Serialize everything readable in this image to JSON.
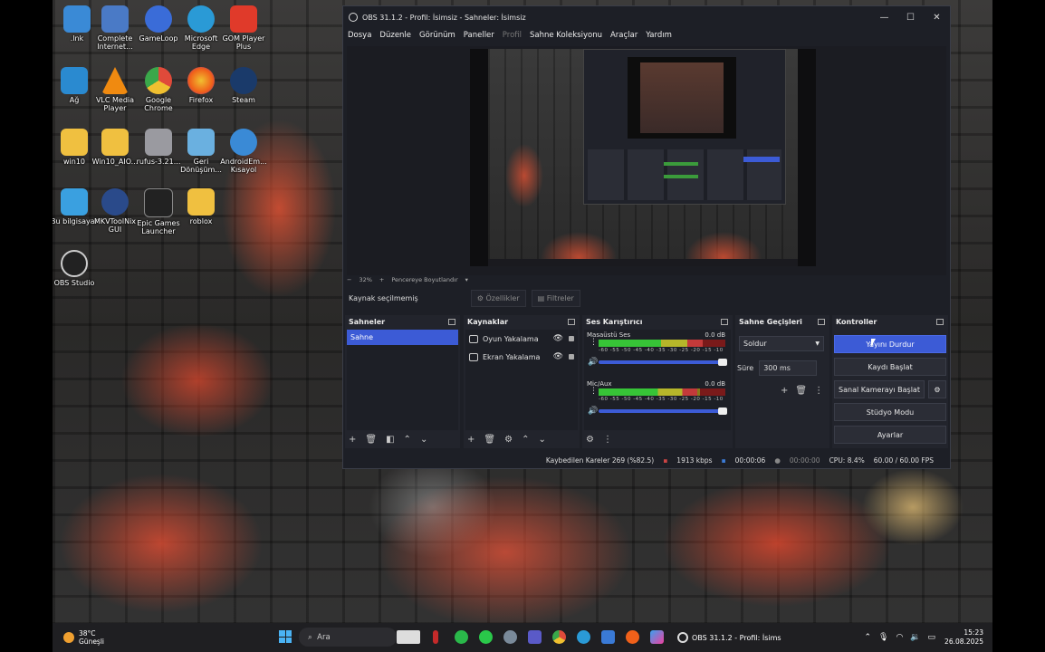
{
  "desktop": {
    "icons": [
      {
        "label": ".lnk",
        "color": "#3a8ad6"
      },
      {
        "label": "Complete Internet...",
        "color": "#4a7ac6"
      },
      {
        "label": "GameLoop",
        "color": "#3a6cd8"
      },
      {
        "label": "Microsoft Edge",
        "color": "#2a9ad6"
      },
      {
        "label": "GOM Player Plus",
        "color": "#e03a2a"
      },
      {
        "label": "Ağ",
        "color": "#2a8ad0"
      },
      {
        "label": "VLC Media Player",
        "color": "#f08a10"
      },
      {
        "label": "Google Chrome",
        "color": "#3aa84a"
      },
      {
        "label": "Firefox",
        "color": "#f0601a"
      },
      {
        "label": "Steam",
        "color": "#1a3a6a"
      },
      {
        "label": "win10",
        "color": "#f0c040"
      },
      {
        "label": "Win10_AIO...",
        "color": "#f0c040"
      },
      {
        "label": "rufus-3.21...",
        "color": "#9a9aa0"
      },
      {
        "label": "Geri Dönüşüm...",
        "color": "#6ab0e0"
      },
      {
        "label": "AndroidEm... Kısayol",
        "color": "#3a8ad6"
      },
      {
        "label": "Bu bilgisayar",
        "color": "#3aa0e0"
      },
      {
        "label": "MKVToolNix GUI",
        "color": "#2a4a8a"
      },
      {
        "label": "Epic Games Launcher",
        "color": "#222222"
      },
      {
        "label": "roblox",
        "color": "#f0c040"
      },
      {
        "label": "OBS Studio",
        "color": "#222222"
      }
    ]
  },
  "obs": {
    "title": "OBS 31.1.2 - Profil: İsimsiz - Sahneler: İsimsiz",
    "window_controls": {
      "minimize": "—",
      "maximize": "☐",
      "close": "✕"
    },
    "menu": [
      "Dosya",
      "Düzenle",
      "Görünüm",
      "Paneller",
      "Profil",
      "Sahne Koleksiyonu",
      "Araçlar",
      "Yardım"
    ],
    "zoom": {
      "minus": "−",
      "value": "32%",
      "plus": "+",
      "fit": "Pencereye Boyutlandır",
      "dropdown": "▾"
    },
    "source_bar": {
      "status": "Kaynak seçilmemiş",
      "properties": "Özellikler",
      "filters": "Filtreler"
    },
    "docks": {
      "scenes": {
        "title": "Sahneler",
        "items": [
          "Sahne"
        ]
      },
      "sources": {
        "title": "Kaynaklar",
        "items": [
          "Oyun Yakalama",
          "Ekran Yakalama"
        ]
      },
      "mixer": {
        "title": "Ses Karıştırıcı",
        "channels": [
          {
            "name": "Masaüstü Ses",
            "db": "0.0 dB",
            "level": 0.82,
            "volume": 1.0
          },
          {
            "name": "Mic/Aux",
            "db": "0.0 dB",
            "level": 0.78,
            "volume": 1.0
          }
        ],
        "ticks": "-60 -55 -50 -45 -40 -35 -30 -25 -20 -15 -10 -5 0"
      },
      "transitions": {
        "title": "Sahne Geçişleri",
        "selected": "Soldur",
        "duration_label": "Süre",
        "duration_value": "300 ms"
      },
      "controls": {
        "title": "Kontroller",
        "buttons": [
          "Yayını Durdur",
          "Kaydı Başlat",
          "Sanal Kamerayı Başlat",
          "Stüdyo Modu",
          "Ayarlar"
        ]
      }
    },
    "status": {
      "dropped": "Kaybedilen Kareler 269 (%82.5)",
      "bitrate": "1913 kbps",
      "stream_time": "00:00:06",
      "rec_time": "00:00:00",
      "cpu": "CPU: 8.4%",
      "fps": "60.00 / 60.00 FPS"
    }
  },
  "taskbar": {
    "weather_temp": "38°C",
    "weather_desc": "Güneşli",
    "search_placeholder": "Ara",
    "obs_task_label": "OBS 31.1.2 - Profil: İsims",
    "time": "15:23",
    "date": "26.08.2025"
  },
  "colors": {
    "accent": "#3c5bd6",
    "obs_bg": "#1d1f26",
    "dock_bg": "#22242c"
  }
}
